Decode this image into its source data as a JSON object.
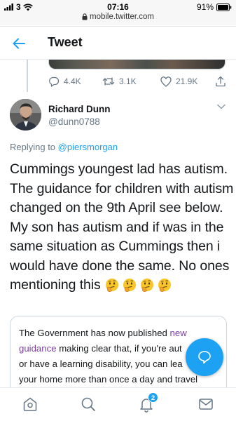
{
  "status_bar": {
    "carrier": "3",
    "time": "07:16",
    "battery": "91%"
  },
  "browser": {
    "url": "mobile.twitter.com"
  },
  "header": {
    "title": "Tweet"
  },
  "parent_tweet": {
    "replies": "4.4K",
    "retweets": "3.1K",
    "likes": "21.9K"
  },
  "tweet": {
    "author_name": "Richard Dunn",
    "author_handle": "@dunn0788",
    "replying_prefix": "Replying to",
    "replying_to": "@piersmorgan",
    "text": "Cummings youngest lad has autism. The guidance for children with autism changed on the 9th April see below. My son has autism and if was in the same situation as Cummings then i would have done the same. No ones mentioning this",
    "emojis": [
      "thinking-face",
      "thinking-face",
      "thinking-face",
      "thinking-face"
    ]
  },
  "quoted_card": {
    "text_before_link": "The Government has now published ",
    "link_text": "new guidance",
    "text_after_link": " making clear that, if you're aut",
    "line3": "or have a learning disability, you can lea",
    "line4": "your home more than once a day and travel"
  },
  "bottom_nav": {
    "notification_count": "2"
  },
  "colors": {
    "accent": "#1da1f2",
    "text": "#14171a",
    "secondary": "#657786"
  }
}
